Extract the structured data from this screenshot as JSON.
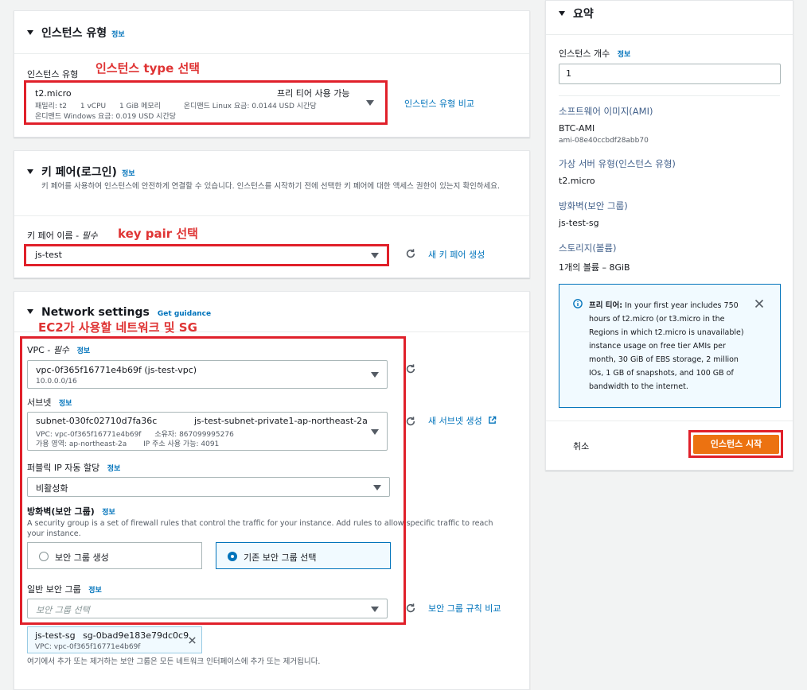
{
  "instance_type_section": {
    "title": "인스턴스 유형",
    "info": "정보",
    "label": "인스턴스 유형",
    "annotation": "인스턴스 type 선택",
    "selected": {
      "name": "t2.micro",
      "free_tier": "프리 티어 사용 가능",
      "line1_family": "패밀리: t2",
      "line1_vcpu": "1 vCPU",
      "line1_memory": "1 GiB 메모리",
      "line1_linux_price": "온디맨드 Linux 요금: 0.0144 USD 시간당",
      "line2_windows_price": "온디맨드 Windows 요금: 0.019 USD 시간당"
    },
    "compare_link": "인스턴스 유형 비교"
  },
  "key_pair_section": {
    "title": "키 페어(로그인)",
    "info": "정보",
    "description": "키 페어를 사용하여 인스턴스에 안전하게 연결할 수 있습니다. 인스턴스를 시작하기 전에 선택한 키 페어에 대한 액세스 권한이 있는지 확인하세요.",
    "label": "키 페어 이름 -",
    "required": "필수",
    "annotation": "key pair 선택",
    "selected": "js-test",
    "create_link": "새 키 페어 생성"
  },
  "network_section": {
    "title": "Network settings",
    "guidance": "Get guidance",
    "annotation": "EC2가 사용할 네트워크 및 SG",
    "vpc": {
      "label": "VPC -",
      "required": "필수",
      "info": "정보",
      "value": "vpc-0f365f16771e4b69f (js-test-vpc)",
      "cidr": "10.0.0.0/16"
    },
    "subnet": {
      "label": "서브넷",
      "info": "정보",
      "id": "subnet-030fc02710d7fa36c",
      "name": "js-test-subnet-private1-ap-northeast-2a",
      "vpc_line": "VPC: vpc-0f365f16771e4b69f",
      "owner_line": "소유자: 867099995276",
      "az_line": "가용 영역: ap-northeast-2a",
      "ip_line": "IP 주소 사용 가능: 4091",
      "create_link": "새 서브넷 생성"
    },
    "public_ip": {
      "label": "퍼블릭 IP 자동 할당",
      "info": "정보",
      "value": "비활성화"
    },
    "firewall": {
      "label": "방화벽(보안 그룹)",
      "info": "정보",
      "description": "A security group is a set of firewall rules that control the traffic for your instance. Add rules to allow specific traffic to reach your instance.",
      "option_create": "보안 그룹 생성",
      "option_existing": "기존 보안 그룹 선택"
    },
    "common_sg": {
      "label": "일반 보안 그룹",
      "info": "정보",
      "placeholder": "보안 그룹 선택",
      "compare_link": "보안 그룹 규칙 비교"
    },
    "selected_sg": {
      "name": "js-test-sg",
      "id": "sg-0bad9e183e79dc0c9",
      "vpc": "VPC: vpc-0f365f16771e4b69f"
    },
    "footnote": "여기에서 추가 또는 제거하는 보안 그룹은 모든 네트워크 인터페이스에 추가 또는 제거됩니다."
  },
  "summary": {
    "title": "요약",
    "instance_count_label": "인스턴스 개수",
    "info": "정보",
    "instance_count": "1",
    "ami_label": "소프트웨어 이미지(AMI)",
    "ami_name": "BTC-AMI",
    "ami_id": "ami-08e40ccbdf28abb70",
    "server_type_label": "가상 서버 유형(인스턴스 유형)",
    "server_type": "t2.micro",
    "firewall_label": "방화벽(보안 그룹)",
    "firewall": "js-test-sg",
    "storage_label": "스토리지(볼륨)",
    "storage": "1개의 볼륨 – 8GiB",
    "free_tier_title": "프리 티어:",
    "free_tier_text": "In your first year includes 750 hours of t2.micro (or t3.micro in the Regions in which t2.micro is unavailable) instance usage on free tier AMIs per month, 30 GiB of EBS storage, 2 million IOs, 1 GB of snapshots, and 100 GB of bandwidth to the internet.",
    "cancel": "취소",
    "launch": "인스턴스 시작"
  },
  "colors": {
    "accent": "#0073bb",
    "annotation_red": "#df3434",
    "launch_orange": "#ec7211"
  }
}
